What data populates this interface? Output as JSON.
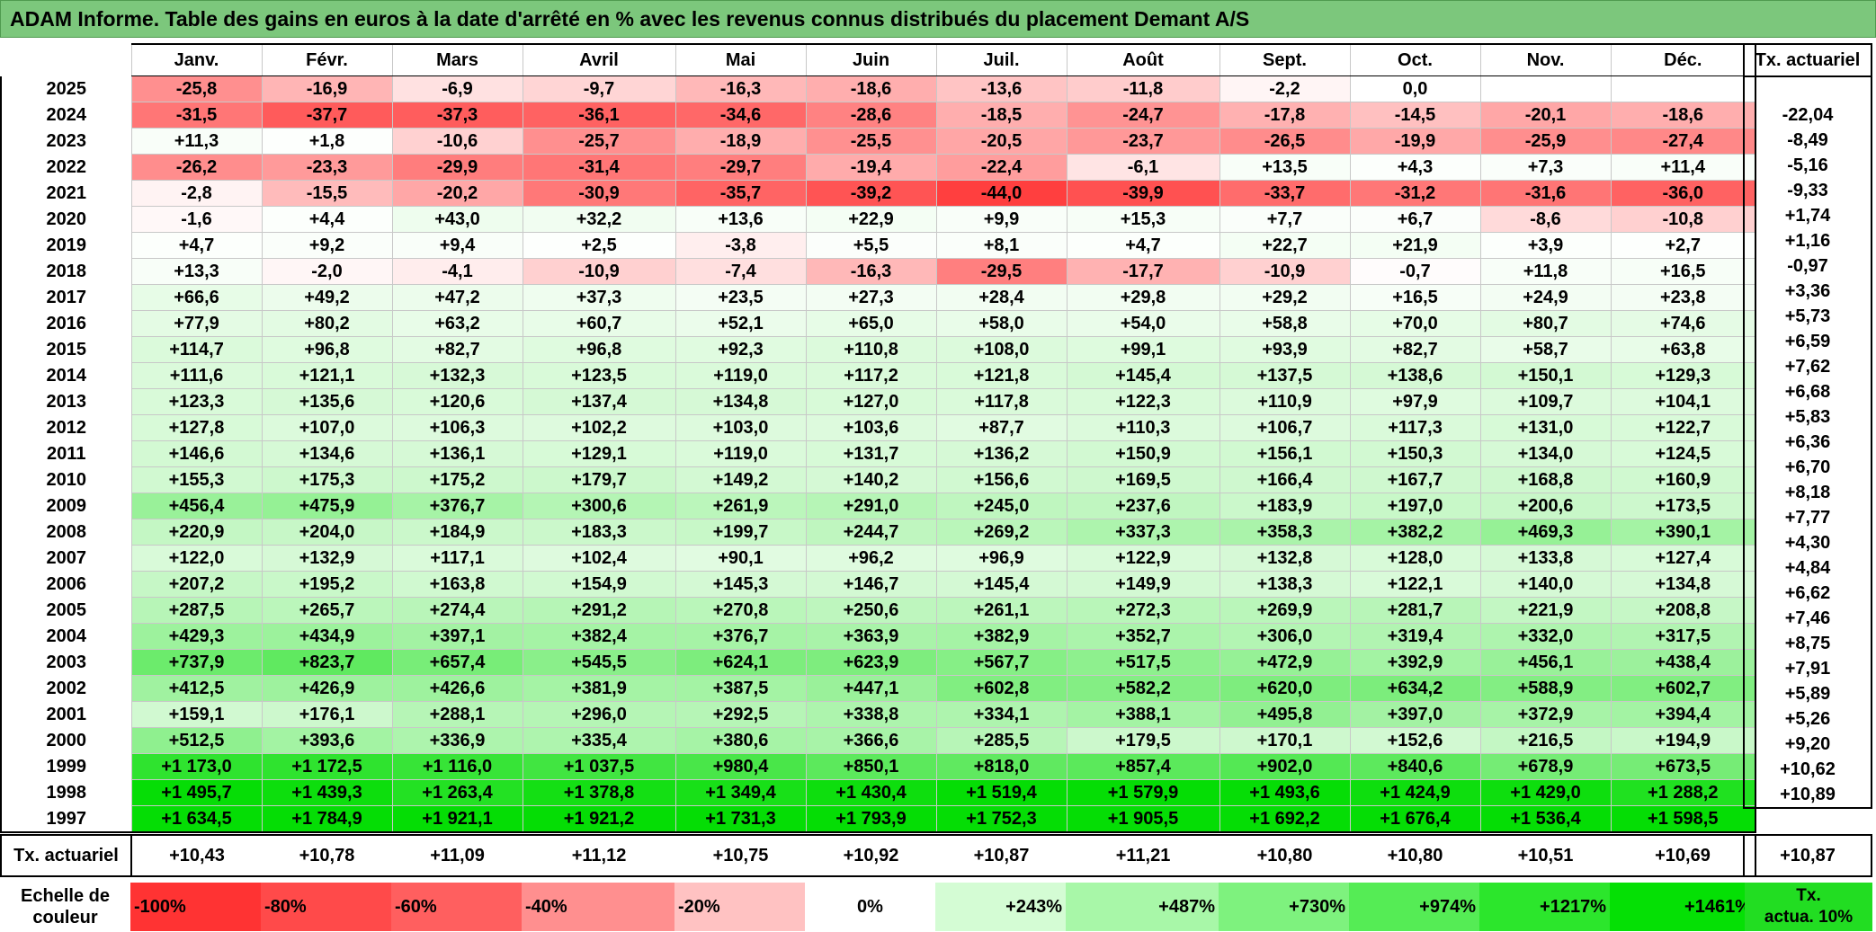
{
  "title": "ADAM Informe. Table des gains en euros à la date d'arrêté en % avec les revenus connus distribués du placement Demant A/S",
  "months": [
    "Janv.",
    "Févr.",
    "Mars",
    "Avril",
    "Mai",
    "Juin",
    "Juil.",
    "Août",
    "Sept.",
    "Oct.",
    "Nov.",
    "Déc."
  ],
  "side_header": "Tx. actuariel",
  "rows": [
    {
      "year": "2025",
      "cells": [
        "-25,8",
        "-16,9",
        "-6,9",
        "-9,7",
        "-16,3",
        "-18,6",
        "-13,6",
        "-11,8",
        "-2,2",
        "0,0",
        "",
        ""
      ],
      "tx": ""
    },
    {
      "year": "2024",
      "cells": [
        "-31,5",
        "-37,7",
        "-37,3",
        "-36,1",
        "-34,6",
        "-28,6",
        "-18,5",
        "-24,7",
        "-17,8",
        "-14,5",
        "-20,1",
        "-18,6"
      ],
      "tx": "-22,04"
    },
    {
      "year": "2023",
      "cells": [
        "+11,3",
        "+1,8",
        "-10,6",
        "-25,7",
        "-18,9",
        "-25,5",
        "-20,5",
        "-23,7",
        "-26,5",
        "-19,9",
        "-25,9",
        "-27,4"
      ],
      "tx": "-8,49"
    },
    {
      "year": "2022",
      "cells": [
        "-26,2",
        "-23,3",
        "-29,9",
        "-31,4",
        "-29,7",
        "-19,4",
        "-22,4",
        "-6,1",
        "+13,5",
        "+4,3",
        "+7,3",
        "+11,4"
      ],
      "tx": "-5,16"
    },
    {
      "year": "2021",
      "cells": [
        "-2,8",
        "-15,5",
        "-20,2",
        "-30,9",
        "-35,7",
        "-39,2",
        "-44,0",
        "-39,9",
        "-33,7",
        "-31,2",
        "-31,6",
        "-36,0"
      ],
      "tx": "-9,33"
    },
    {
      "year": "2020",
      "cells": [
        "-1,6",
        "+4,4",
        "+43,0",
        "+32,2",
        "+13,6",
        "+22,9",
        "+9,9",
        "+15,3",
        "+7,7",
        "+6,7",
        "-8,6",
        "-10,8"
      ],
      "tx": "+1,74"
    },
    {
      "year": "2019",
      "cells": [
        "+4,7",
        "+9,2",
        "+9,4",
        "+2,5",
        "-3,8",
        "+5,5",
        "+8,1",
        "+4,7",
        "+22,7",
        "+21,9",
        "+3,9",
        "+2,7"
      ],
      "tx": "+1,16"
    },
    {
      "year": "2018",
      "cells": [
        "+13,3",
        "-2,0",
        "-4,1",
        "-10,9",
        "-7,4",
        "-16,3",
        "-29,5",
        "-17,7",
        "-10,9",
        "-0,7",
        "+11,8",
        "+16,5"
      ],
      "tx": "-0,97"
    },
    {
      "year": "2017",
      "cells": [
        "+66,6",
        "+49,2",
        "+47,2",
        "+37,3",
        "+23,5",
        "+27,3",
        "+28,4",
        "+29,8",
        "+29,2",
        "+16,5",
        "+24,9",
        "+23,8"
      ],
      "tx": "+3,36"
    },
    {
      "year": "2016",
      "cells": [
        "+77,9",
        "+80,2",
        "+63,2",
        "+60,7",
        "+52,1",
        "+65,0",
        "+58,0",
        "+54,0",
        "+58,8",
        "+70,0",
        "+80,7",
        "+74,6"
      ],
      "tx": "+5,73"
    },
    {
      "year": "2015",
      "cells": [
        "+114,7",
        "+96,8",
        "+82,7",
        "+96,8",
        "+92,3",
        "+110,8",
        "+108,0",
        "+99,1",
        "+93,9",
        "+82,7",
        "+58,7",
        "+63,8"
      ],
      "tx": "+6,59"
    },
    {
      "year": "2014",
      "cells": [
        "+111,6",
        "+121,1",
        "+132,3",
        "+123,5",
        "+119,0",
        "+117,2",
        "+121,8",
        "+145,4",
        "+137,5",
        "+138,6",
        "+150,1",
        "+129,3"
      ],
      "tx": "+7,62"
    },
    {
      "year": "2013",
      "cells": [
        "+123,3",
        "+135,6",
        "+120,6",
        "+137,4",
        "+134,8",
        "+127,0",
        "+117,8",
        "+122,3",
        "+110,9",
        "+97,9",
        "+109,7",
        "+104,1"
      ],
      "tx": "+6,68"
    },
    {
      "year": "2012",
      "cells": [
        "+127,8",
        "+107,0",
        "+106,3",
        "+102,2",
        "+103,0",
        "+103,6",
        "+87,7",
        "+110,3",
        "+106,7",
        "+117,3",
        "+131,0",
        "+122,7"
      ],
      "tx": "+5,83"
    },
    {
      "year": "2011",
      "cells": [
        "+146,6",
        "+134,6",
        "+136,1",
        "+129,1",
        "+119,0",
        "+131,7",
        "+136,2",
        "+150,9",
        "+156,1",
        "+150,3",
        "+134,0",
        "+124,5"
      ],
      "tx": "+6,36"
    },
    {
      "year": "2010",
      "cells": [
        "+155,3",
        "+175,3",
        "+175,2",
        "+179,7",
        "+149,2",
        "+140,2",
        "+156,6",
        "+169,5",
        "+166,4",
        "+167,7",
        "+168,8",
        "+160,9"
      ],
      "tx": "+6,70"
    },
    {
      "year": "2009",
      "cells": [
        "+456,4",
        "+475,9",
        "+376,7",
        "+300,6",
        "+261,9",
        "+291,0",
        "+245,0",
        "+237,6",
        "+183,9",
        "+197,0",
        "+200,6",
        "+173,5"
      ],
      "tx": "+8,18"
    },
    {
      "year": "2008",
      "cells": [
        "+220,9",
        "+204,0",
        "+184,9",
        "+183,3",
        "+199,7",
        "+244,7",
        "+269,2",
        "+337,3",
        "+358,3",
        "+382,2",
        "+469,3",
        "+390,1"
      ],
      "tx": "+7,77"
    },
    {
      "year": "2007",
      "cells": [
        "+122,0",
        "+132,9",
        "+117,1",
        "+102,4",
        "+90,1",
        "+96,2",
        "+96,9",
        "+122,9",
        "+132,8",
        "+128,0",
        "+133,8",
        "+127,4"
      ],
      "tx": "+4,30"
    },
    {
      "year": "2006",
      "cells": [
        "+207,2",
        "+195,2",
        "+163,8",
        "+154,9",
        "+145,3",
        "+146,7",
        "+145,4",
        "+149,9",
        "+138,3",
        "+122,1",
        "+140,0",
        "+134,8"
      ],
      "tx": "+4,84"
    },
    {
      "year": "2005",
      "cells": [
        "+287,5",
        "+265,7",
        "+274,4",
        "+291,2",
        "+270,8",
        "+250,6",
        "+261,1",
        "+272,3",
        "+269,9",
        "+281,7",
        "+221,9",
        "+208,8"
      ],
      "tx": "+6,62"
    },
    {
      "year": "2004",
      "cells": [
        "+429,3",
        "+434,9",
        "+397,1",
        "+382,4",
        "+376,7",
        "+363,9",
        "+382,9",
        "+352,7",
        "+306,0",
        "+319,4",
        "+332,0",
        "+317,5"
      ],
      "tx": "+7,46"
    },
    {
      "year": "2003",
      "cells": [
        "+737,9",
        "+823,7",
        "+657,4",
        "+545,5",
        "+624,1",
        "+623,9",
        "+567,7",
        "+517,5",
        "+472,9",
        "+392,9",
        "+456,1",
        "+438,4"
      ],
      "tx": "+8,75"
    },
    {
      "year": "2002",
      "cells": [
        "+412,5",
        "+426,9",
        "+426,6",
        "+381,9",
        "+387,5",
        "+447,1",
        "+602,8",
        "+582,2",
        "+620,0",
        "+634,2",
        "+588,9",
        "+602,7"
      ],
      "tx": "+7,91"
    },
    {
      "year": "2001",
      "cells": [
        "+159,1",
        "+176,1",
        "+288,1",
        "+296,0",
        "+292,5",
        "+338,8",
        "+334,1",
        "+388,1",
        "+495,8",
        "+397,0",
        "+372,9",
        "+394,4"
      ],
      "tx": "+5,89"
    },
    {
      "year": "2000",
      "cells": [
        "+512,5",
        "+393,6",
        "+336,9",
        "+335,4",
        "+380,6",
        "+366,6",
        "+285,5",
        "+179,5",
        "+170,1",
        "+152,6",
        "+216,5",
        "+194,9"
      ],
      "tx": "+5,26"
    },
    {
      "year": "1999",
      "cells": [
        "+1 173,0",
        "+1 172,5",
        "+1 116,0",
        "+1 037,5",
        "+980,4",
        "+850,1",
        "+818,0",
        "+857,4",
        "+902,0",
        "+840,6",
        "+678,9",
        "+673,5"
      ],
      "tx": "+9,20"
    },
    {
      "year": "1998",
      "cells": [
        "+1 495,7",
        "+1 439,3",
        "+1 263,4",
        "+1 378,8",
        "+1 349,4",
        "+1 430,4",
        "+1 519,4",
        "+1 579,9",
        "+1 493,6",
        "+1 424,9",
        "+1 429,0",
        "+1 288,2"
      ],
      "tx": "+10,62"
    },
    {
      "year": "1997",
      "cells": [
        "+1 634,5",
        "+1 784,9",
        "+1 921,1",
        "+1 921,2",
        "+1 731,3",
        "+1 793,9",
        "+1 752,3",
        "+1 905,5",
        "+1 692,2",
        "+1 676,4",
        "+1 536,4",
        "+1 598,5"
      ],
      "tx": "+10,89"
    }
  ],
  "tx_row": {
    "label": "Tx. actuariel",
    "values": [
      "+10,43",
      "+10,78",
      "+11,09",
      "+11,12",
      "+10,75",
      "+10,92",
      "+10,87",
      "+11,21",
      "+10,80",
      "+10,80",
      "+10,51",
      "+10,69"
    ],
    "total": "+10,87"
  },
  "legend": {
    "label_line1": "Echelle de",
    "label_line2": "couleur",
    "swatches": [
      {
        "label": "-100%",
        "color": "#ff3333"
      },
      {
        "label": "-80%",
        "color": "#ff4a4a"
      },
      {
        "label": "-60%",
        "color": "#ff5f5f"
      },
      {
        "label": "-40%",
        "color": "#ff8f8f"
      },
      {
        "label": "-20%",
        "color": "#ffc2c2"
      },
      {
        "label": "0%",
        "color": "#ffffff"
      },
      {
        "label": "+243%",
        "color": "#d4fcd4"
      },
      {
        "label": "+487%",
        "color": "#a8f7a8"
      },
      {
        "label": "+730%",
        "color": "#7ef27e"
      },
      {
        "label": "+974%",
        "color": "#55ec55"
      },
      {
        "label": "+1217%",
        "color": "#2ce62c"
      },
      {
        "label": "+1461%",
        "color": "#05e005"
      }
    ],
    "side_line1": "Tx.",
    "side_line2": "actua. 10%",
    "side_color": "#22dd22"
  },
  "colors": {
    "title_bg": "#7cc77c",
    "negative_max": "#ff3b3b",
    "positive_max": "#05dd05"
  }
}
